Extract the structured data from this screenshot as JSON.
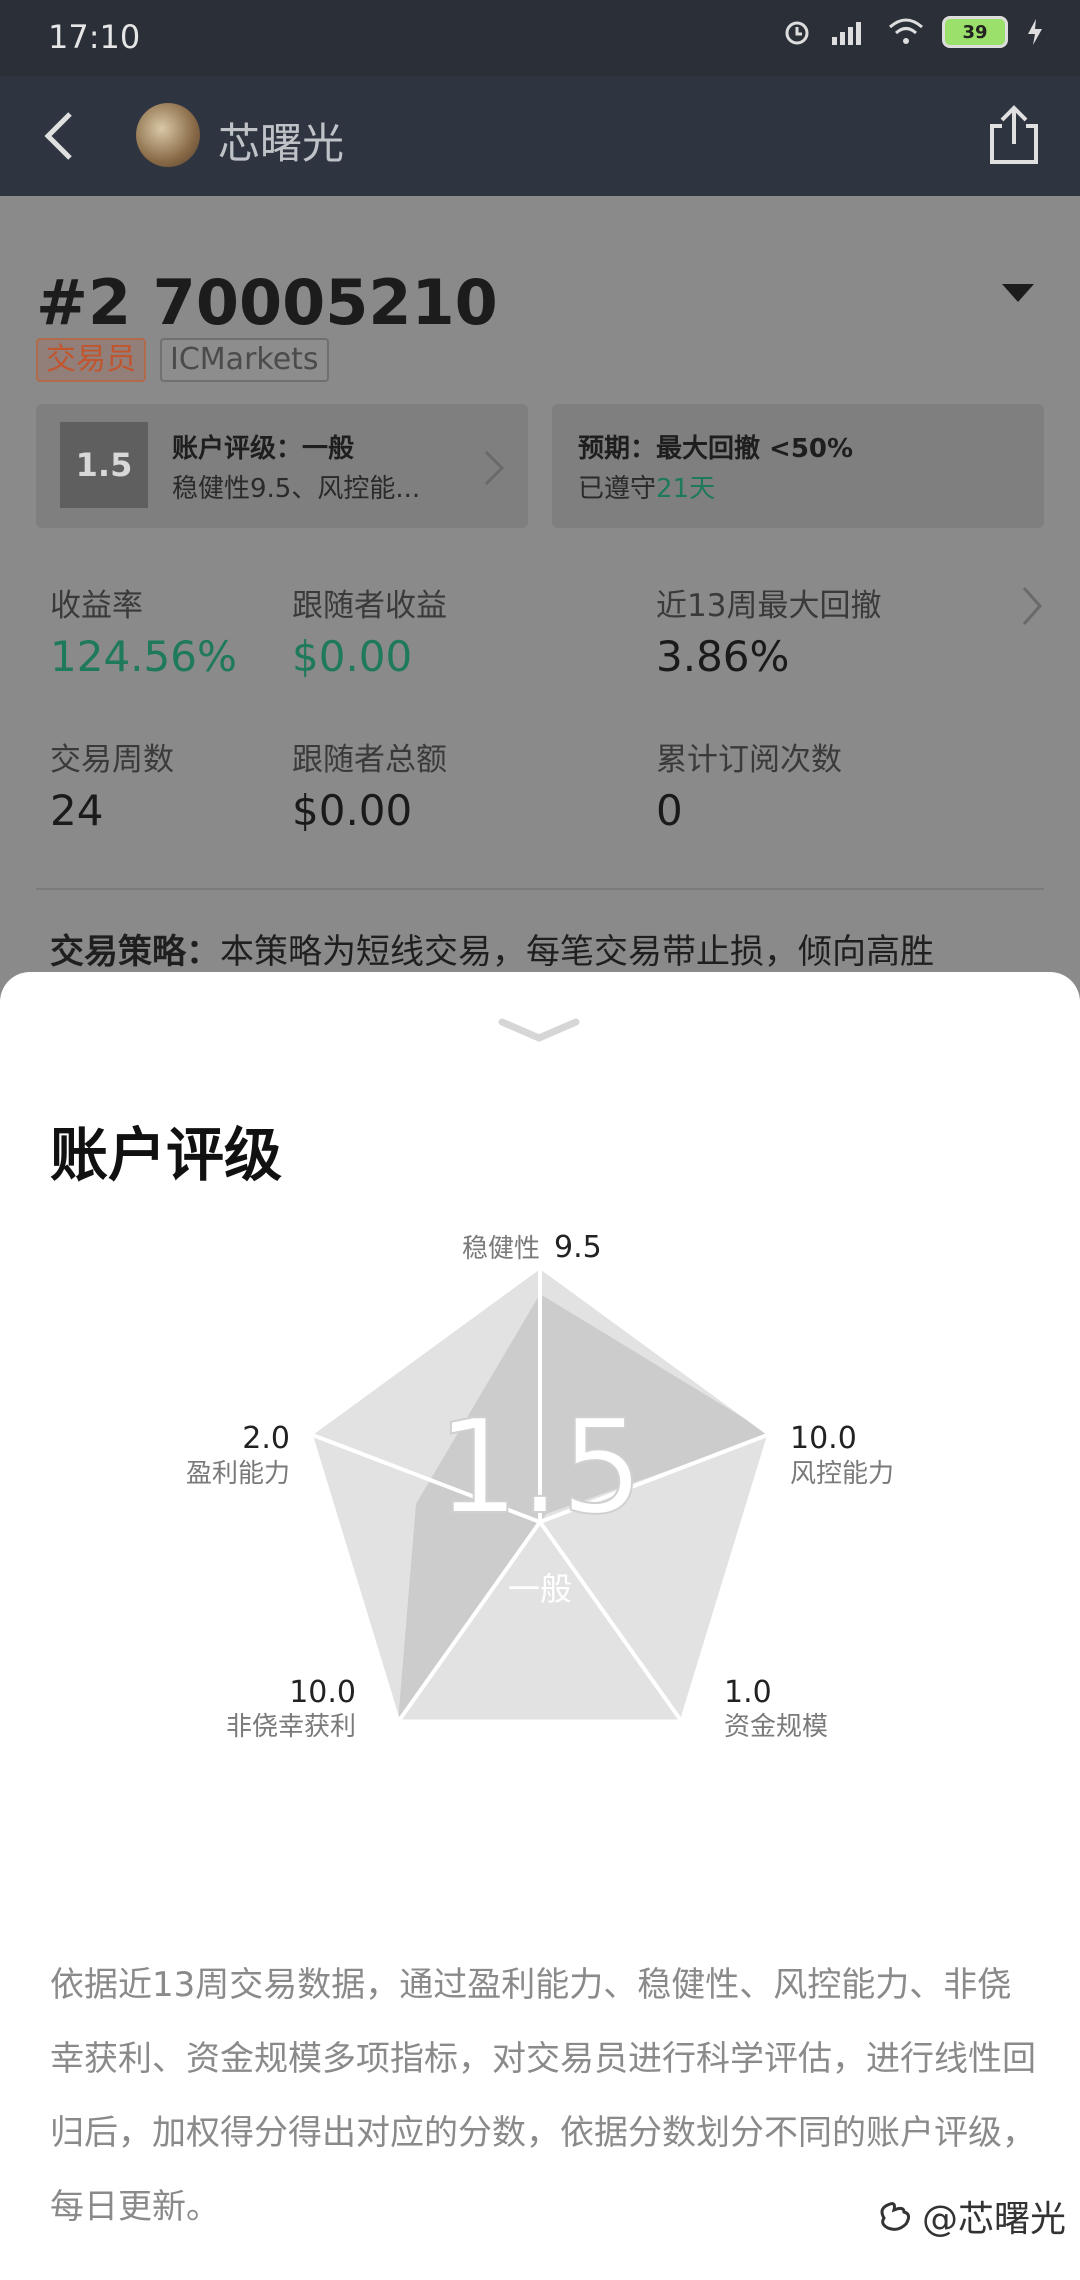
{
  "status_bar": {
    "time": "17:10",
    "battery": "39"
  },
  "app_bar": {
    "title": "芯曙光"
  },
  "account": {
    "id": "#2 70005210",
    "tags": [
      "交易员",
      "ICMarkets"
    ],
    "rating_card": {
      "score": "1.5",
      "title": "账户评级：一般",
      "subtitle": "稳健性9.5、风控能..."
    },
    "expect_card": {
      "title": "预期：最大回撤 <50%",
      "subtitle_prefix": "已遵守",
      "days": "21天"
    }
  },
  "stats": {
    "return_label": "收益率",
    "return_value": "124.56%",
    "follower_profit_label": "跟随者收益",
    "follower_profit_value": "$0.00",
    "drawdown_label": "近13周最大回撤",
    "drawdown_value": "3.86%",
    "weeks_label": "交易周数",
    "weeks_value": "24",
    "follower_total_label": "跟随者总额",
    "follower_total_value": "$0.00",
    "subs_label": "累计订阅次数",
    "subs_value": "0"
  },
  "strategy": {
    "label": "交易策略：",
    "text": "本策略为短线交易，每笔交易带止损，倾向高胜"
  },
  "sheet": {
    "title": "账户评级",
    "center_score": "1.5",
    "center_label": "一般",
    "axes": [
      {
        "label": "稳健性",
        "value": "9.5"
      },
      {
        "label": "风控能力",
        "value": "10.0"
      },
      {
        "label": "资金规模",
        "value": "1.0"
      },
      {
        "label": "非侥幸获利",
        "value": "10.0"
      },
      {
        "label": "盈利能力",
        "value": "2.0"
      }
    ],
    "description": "依据近13周交易数据，通过盈利能力、稳健性、风控能力、非侥幸获利、资金规模多项指标，对交易员进行科学评估，进行线性回归后，加权得分得出对应的分数，依据分数划分不同的账户评级，每日更新。"
  },
  "watermark": "@芯曙光",
  "colors": {
    "green": "#1e7a5a",
    "tag_orange": "#c0552e"
  }
}
